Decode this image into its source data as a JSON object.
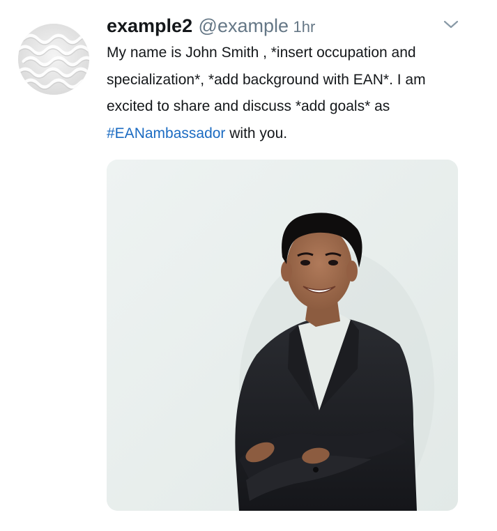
{
  "tweet": {
    "display_name": "example2",
    "handle": "@example",
    "time": "1hr",
    "text_before": "My name is John Smith , *insert occupation and specialization*, *add background with EAN*. I am excited to share and discuss *add goals* as ",
    "hashtag": "#EANambassador",
    "text_after": " with you.",
    "avatar_icon": "avatar-icon",
    "menu_icon": "chevron-down-icon",
    "media_description_icon": "photo"
  },
  "colors": {
    "name": "#14171a",
    "secondary": "#657786",
    "hashtag": "#1b6bc2"
  }
}
